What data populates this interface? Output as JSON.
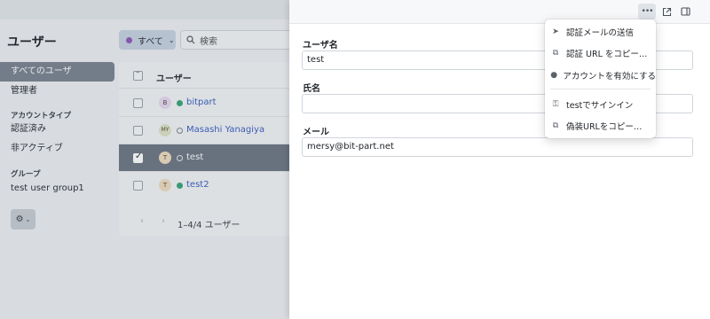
{
  "sidebar": {
    "title": "ユーザー",
    "items": [
      {
        "label": "すべてのユーザ"
      },
      {
        "label": "管理者"
      }
    ],
    "account_type_section": "アカウントタイプ",
    "account_type_items": [
      {
        "label": "認証済み"
      },
      {
        "label": "非アクティブ"
      }
    ],
    "group_section": "グループ",
    "group_items": [
      {
        "label": "test user group1"
      }
    ],
    "gear_icon": "gear-icon"
  },
  "toolbar": {
    "filter_label": "すべて",
    "search_placeholder": "検索"
  },
  "table": {
    "header": "ユーザー",
    "rows": [
      {
        "initial": "B",
        "name": "bitpart",
        "status": "active",
        "avatar_color": "#e7d9f0"
      },
      {
        "initial": "MY",
        "name": "Masashi Yanagiya",
        "status": "inactive",
        "avatar_color": "#dfe3c8"
      },
      {
        "initial": "T",
        "name": "test",
        "status": "inactive",
        "avatar_color": "#f0dcc2",
        "selected": true
      },
      {
        "initial": "T",
        "name": "test2",
        "status": "active",
        "avatar_color": "#f0dcc2"
      }
    ],
    "pager_text": "1–4/4 ユーザー"
  },
  "panel": {
    "fields": [
      {
        "label": "ユーザ名",
        "value": "test"
      },
      {
        "label": "氏名",
        "value": ""
      },
      {
        "label": "メール",
        "value": "mersy@bit-part.net"
      }
    ]
  },
  "menu": {
    "items": [
      {
        "label": "認証メールの送信",
        "icon": "send-icon"
      },
      {
        "label": "認証 URL をコピー…",
        "icon": "copy-icon"
      },
      {
        "label": "アカウントを有効にする",
        "icon": "circle-icon"
      },
      {
        "label": "testでサインイン",
        "icon": "key-icon"
      },
      {
        "label": "偽装URLをコピー…",
        "icon": "copy-icon"
      }
    ]
  },
  "colors": {
    "accent_link": "#3b5fc0",
    "status_active": "#3aa57a",
    "selection": "#6f7785"
  }
}
